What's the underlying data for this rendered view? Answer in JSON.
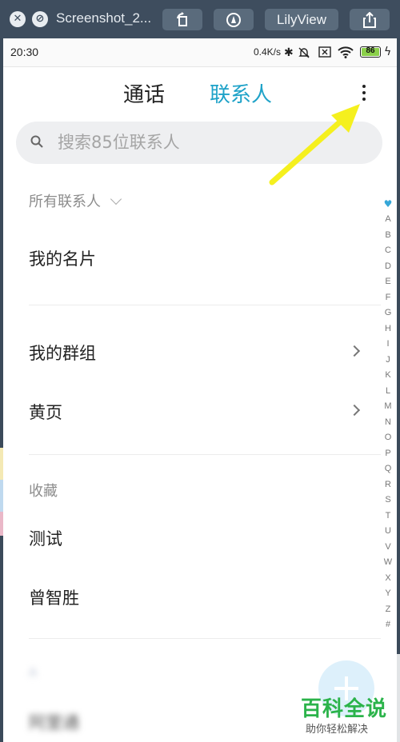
{
  "viewer": {
    "title": "Screenshot_2...",
    "app_button": "LilyView"
  },
  "status": {
    "time": "20:30",
    "net_speed": "0.4K/s",
    "battery": "86",
    "icons": [
      "bluetooth-icon",
      "mute-icon",
      "sim-x-icon",
      "wifi-icon",
      "battery-icon",
      "charging-icon"
    ]
  },
  "tabs": {
    "calls": "通话",
    "contacts": "联系人"
  },
  "search": {
    "placeholder": "搜索85位联系人"
  },
  "list": {
    "all_contacts": "所有联系人",
    "my_card": "我的名片",
    "my_groups": "我的群组",
    "yellow_pages": "黄页",
    "favorites_header": "收藏",
    "favorites": [
      "测试",
      "曾智胜"
    ],
    "section_a": "A",
    "blurred_contact": "阿里通"
  },
  "index_letters": [
    "A",
    "B",
    "C",
    "D",
    "E",
    "F",
    "G",
    "H",
    "I",
    "J",
    "K",
    "L",
    "M",
    "N",
    "O",
    "P",
    "Q",
    "R",
    "S",
    "T",
    "U",
    "V",
    "W",
    "X",
    "Y",
    "Z",
    "#"
  ],
  "watermark": {
    "brand": "百科全说",
    "slogan": "助你轻松解决"
  },
  "colors": {
    "accent": "#1ea2c8",
    "fab": "#1e9ce0",
    "arrow": "#f5f01e"
  }
}
